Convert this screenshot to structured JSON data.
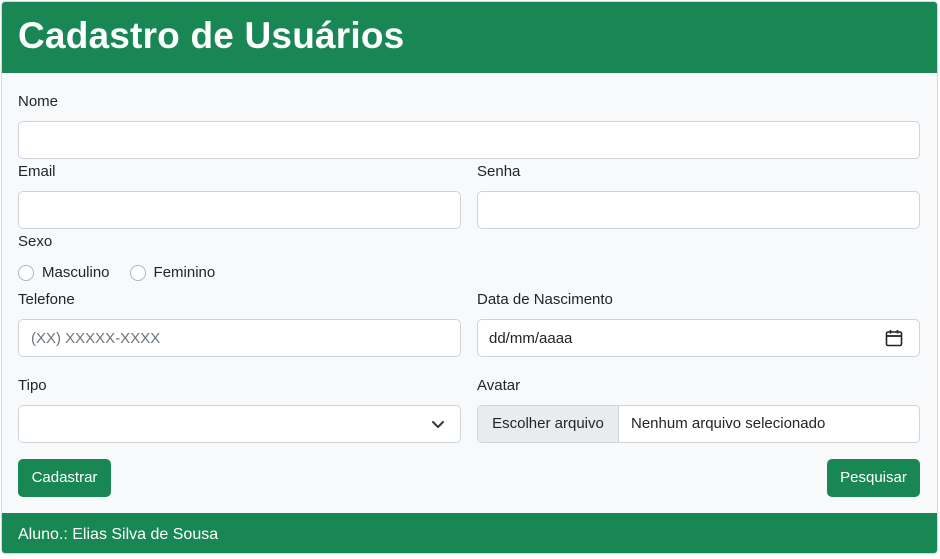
{
  "header": {
    "title": "Cadastro de Usuários"
  },
  "form": {
    "nome": {
      "label": "Nome",
      "value": ""
    },
    "email": {
      "label": "Email",
      "value": ""
    },
    "senha": {
      "label": "Senha",
      "value": ""
    },
    "sexo": {
      "label": "Sexo",
      "options": [
        "Masculino",
        "Feminino"
      ],
      "selected": null
    },
    "telefone": {
      "label": "Telefone",
      "placeholder": "(XX) XXXXX-XXXX",
      "value": ""
    },
    "nascimento": {
      "label": "Data de Nascimento",
      "value_text": "dd/mm/aaaa"
    },
    "tipo": {
      "label": "Tipo",
      "selected": ""
    },
    "avatar": {
      "label": "Avatar",
      "button_label": "Escolher arquivo",
      "status_text": "Nenhum arquivo selecionado"
    }
  },
  "actions": {
    "submit_label": "Cadastrar",
    "search_label": "Pesquisar"
  },
  "footer": {
    "text": "Aluno.: Elias Silva de Sousa"
  },
  "colors": {
    "accent": "#198754",
    "body_bg": "#f8f9fa",
    "border": "#ced4da"
  },
  "icons": {
    "date": "calendar-icon",
    "select": "chevron-down-icon"
  }
}
